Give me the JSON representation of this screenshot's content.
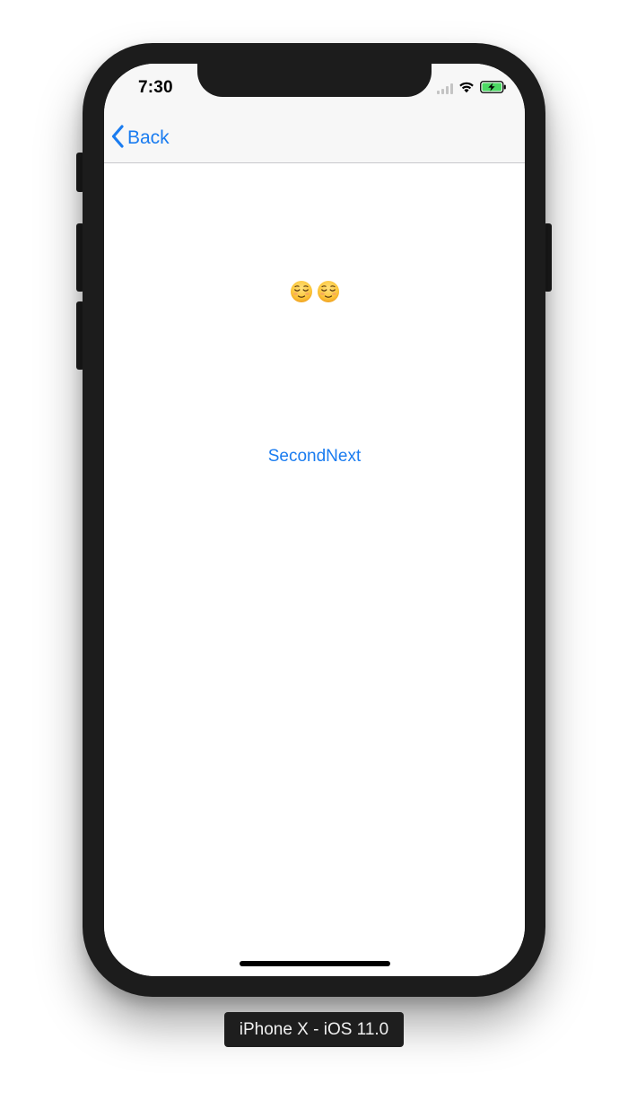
{
  "status_bar": {
    "time": "7:30"
  },
  "navigation": {
    "back_label": "Back",
    "accent_color": "#1a7cf0"
  },
  "content": {
    "emojis": [
      "relieved-face",
      "relieved-face"
    ],
    "link_label": "SecondNext"
  },
  "simulator": {
    "device_label": "iPhone X - iOS 11.0"
  },
  "colors": {
    "device_frame": "#1c1c1c",
    "navbar_bg": "#f7f7f7",
    "battery_fill": "#4cd964"
  }
}
